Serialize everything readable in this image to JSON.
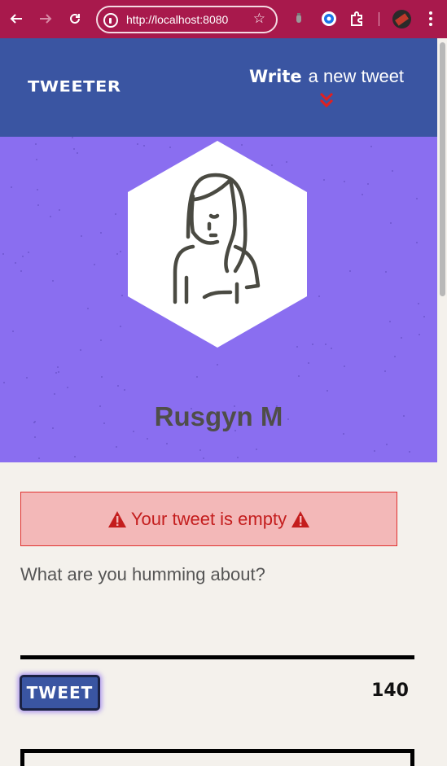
{
  "browser": {
    "url": "http://localhost:8080",
    "colors": {
      "chrome": "#a8194c"
    },
    "icons": [
      "back-icon",
      "forward-icon",
      "reload-icon",
      "site-info-icon",
      "bookmark-star-icon",
      "extension-icon",
      "puzzle-icon",
      "profile-avatar",
      "more-menu-icon"
    ]
  },
  "header": {
    "brand": "TWEETER",
    "compose_bold": "Write",
    "compose_rest": "a new tweet",
    "colors": {
      "background": "#3a55a2",
      "chevron": "#e02020"
    }
  },
  "profile": {
    "name": "Rusgyn M",
    "colors": {
      "background": "#8a6ef0"
    }
  },
  "composer": {
    "error_message": "Your tweet is empty",
    "placeholder": "What are you humming about?",
    "submit_label": "TWEET",
    "char_count": "140",
    "colors": {
      "error_bg": "#f3b8b8",
      "error_text": "#c41d1d"
    }
  }
}
